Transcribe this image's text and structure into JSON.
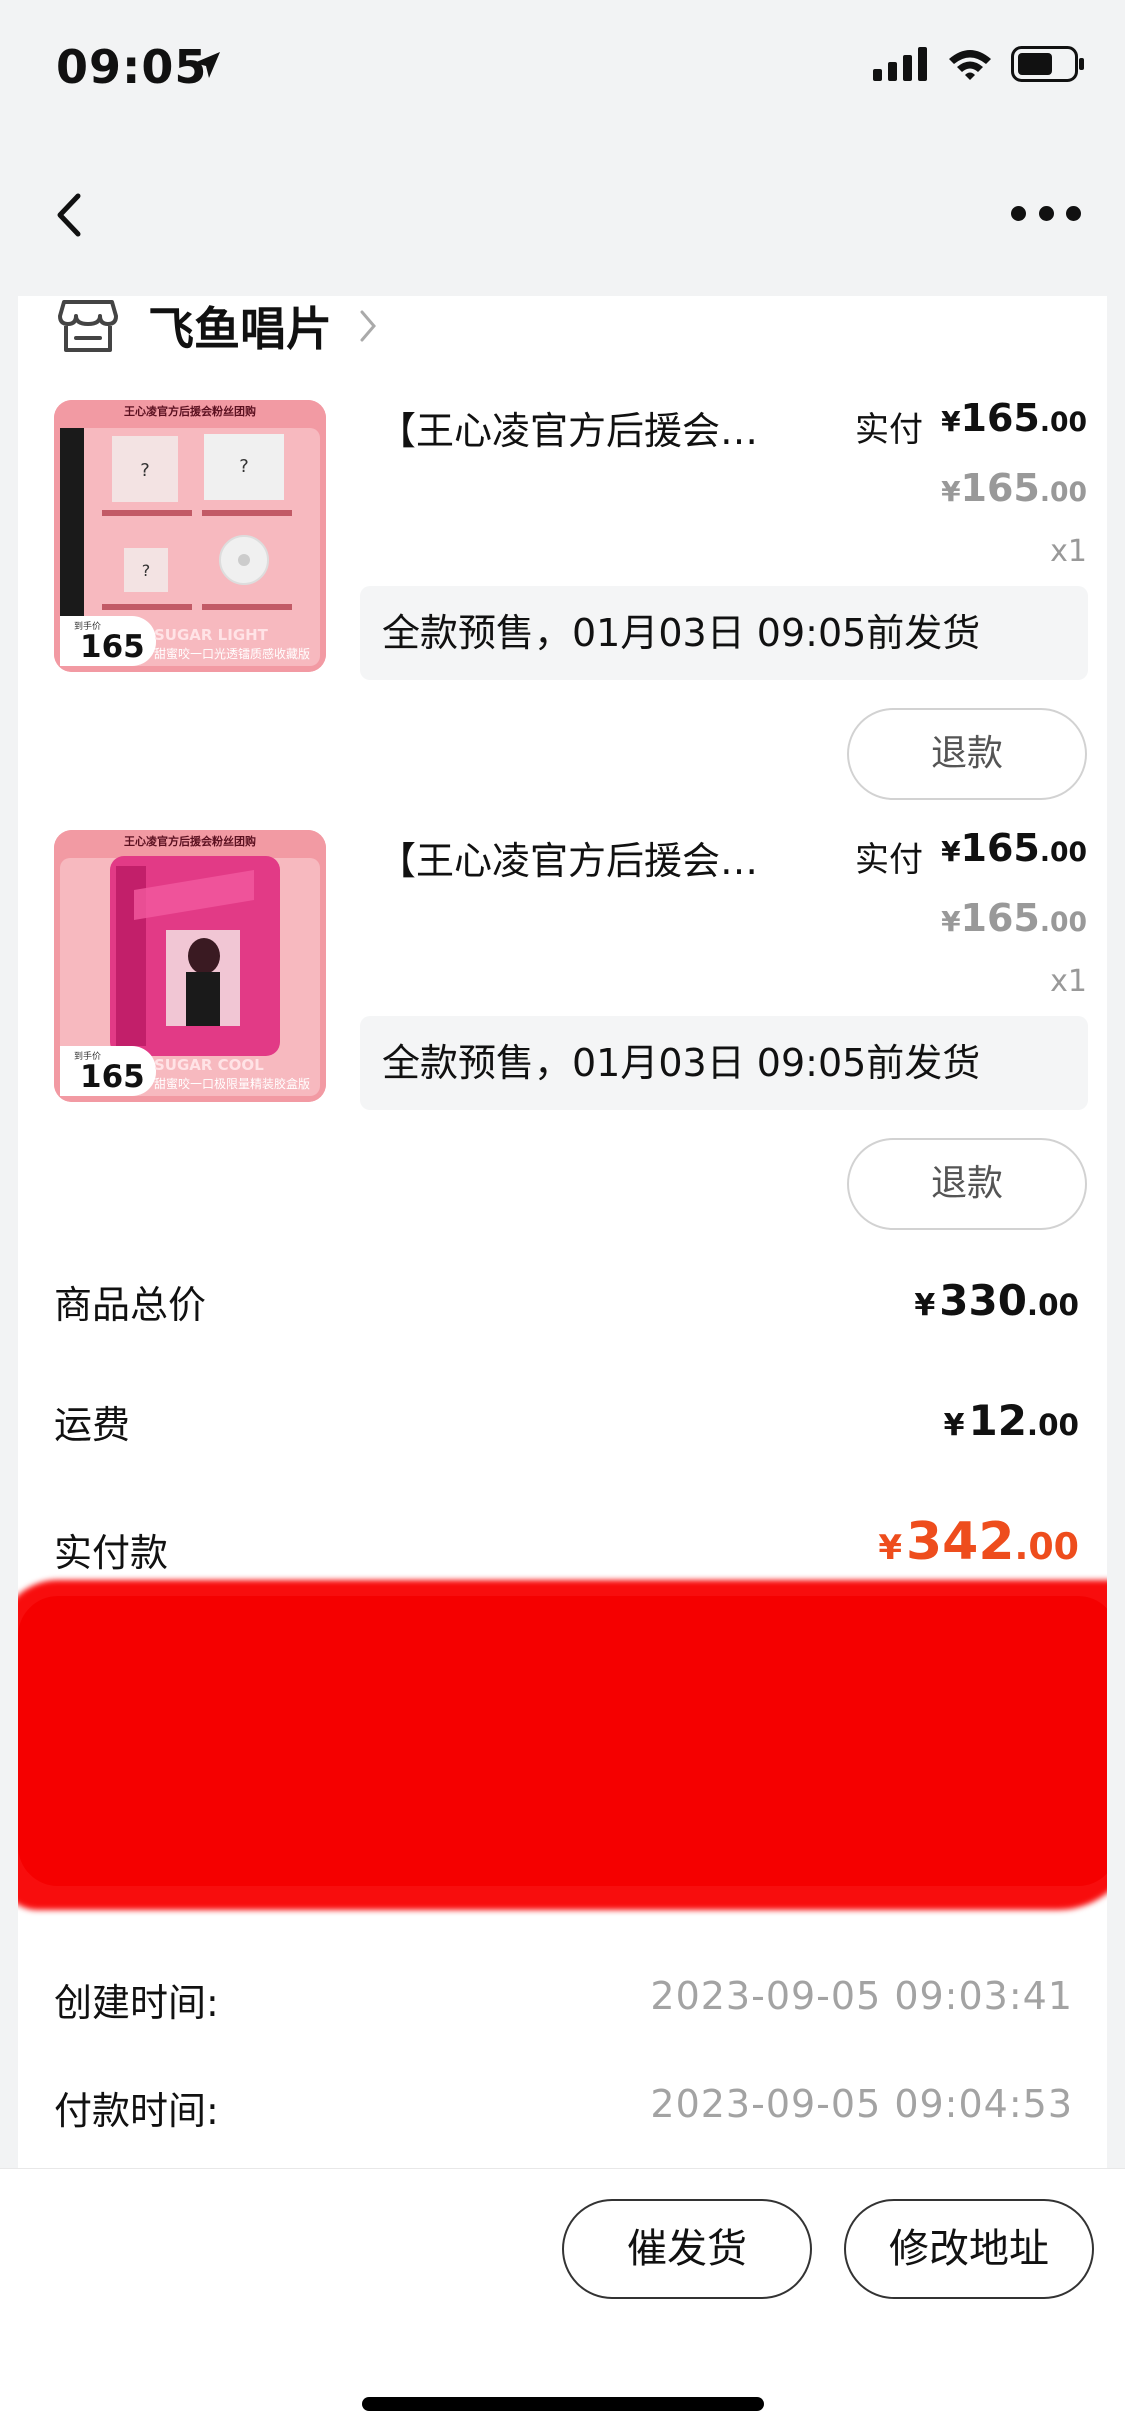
{
  "status": {
    "time": "09:05"
  },
  "shop": {
    "name": "飞鱼唱片"
  },
  "items": [
    {
      "title": "【王心凌官方后援会…",
      "paid_label": "实付",
      "price_yen": "¥",
      "price_int": "165",
      "price_dec": ".00",
      "orig_yen": "¥",
      "orig_int": "165",
      "orig_dec": ".00",
      "qty": "x1",
      "presale": "全款预售，01月03日 09:05前发货",
      "refund": "退款",
      "thumb": {
        "top": "王心凌官方后援会粉丝团购",
        "badge_small": "到手价",
        "badge_num": "165",
        "sub_en": "SUGAR LIGHT",
        "sub_cn": "甜蜜咬一口光透镭质感收藏版"
      }
    },
    {
      "title": "【王心凌官方后援会…",
      "paid_label": "实付",
      "price_yen": "¥",
      "price_int": "165",
      "price_dec": ".00",
      "orig_yen": "¥",
      "orig_int": "165",
      "orig_dec": ".00",
      "qty": "x1",
      "presale": "全款预售，01月03日 09:05前发货",
      "refund": "退款",
      "thumb": {
        "top": "王心凌官方后援会粉丝团购",
        "badge_small": "到手价",
        "badge_num": "165",
        "sub_en": "SUGAR COOL",
        "sub_cn": "甜蜜咬一口极限量精装胶盒版"
      }
    }
  ],
  "summary": {
    "goods_total_label": "商品总价",
    "goods_total_yen": "¥",
    "goods_total_int": "330",
    "goods_total_dec": ".00",
    "shipping_label": "运费",
    "shipping_yen": "¥",
    "shipping_int": "12",
    "shipping_dec": ".00",
    "paid_label": "实付款",
    "paid_yen": "¥",
    "paid_int": "342",
    "paid_dec": ".00"
  },
  "times": {
    "created_label": "创建时间:",
    "created_value": "2023-09-05 09:03:41",
    "paid_label": "付款时间:",
    "paid_value": "2023-09-05 09:04:53"
  },
  "actions": {
    "urge": "催发货",
    "change_address": "修改地址"
  },
  "colors": {
    "accent": "#ee4d1d",
    "redaction": "#f50000",
    "thumb_pink": "#ef8a93"
  }
}
